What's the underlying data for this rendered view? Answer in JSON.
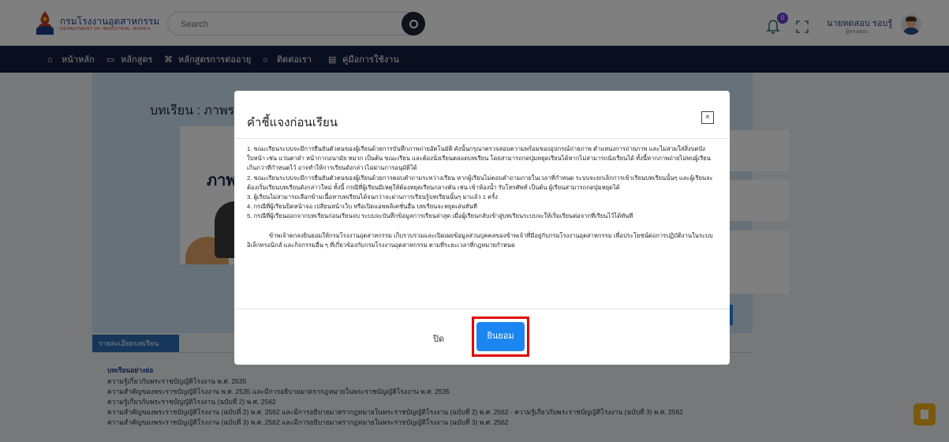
{
  "header": {
    "logo_th": "กรมโรงงานอุตสาหกรรม",
    "logo_en": "DEPARTMENT OF INDUSTRIAL WORKS",
    "search_placeholder": "Search",
    "notification_count": "0",
    "user_name": "นายทดสอบ รอบรู้",
    "user_role": "ผู้ทรงสอบ"
  },
  "nav": {
    "items": [
      {
        "label": "หน้าหลัก",
        "icon": "home-icon"
      },
      {
        "label": "หลักสูตร",
        "icon": "book-icon"
      },
      {
        "label": "หลักสูตรการต่ออายุ",
        "icon": "command-icon"
      },
      {
        "label": "ติดต่อเรา",
        "icon": "chat-icon"
      },
      {
        "label": "คู่มือการใช้งาน",
        "icon": "manual-icon"
      }
    ]
  },
  "page": {
    "lesson_title": "บทเรียน : ภาพร",
    "thumb_text": "ภาพ",
    "detail_tab": "รายละเอียดบทเรียน",
    "summary_heading": "บทเรียนอย่างย่อ",
    "summary_lines": [
      "ความรู้เกี่ยวกับพระราชบัญญัติโรงงาน พ.ศ. 2535",
      "ความสำคัญของพระราชบัญญัติโรงงาน พ.ศ. 2535 และมีการอธิบายมาตรากฎหมายในพระราชบัญญัติโรงงาน พ.ศ. 2535",
      "ความรู้เกี่ยวกับพระราชบัญญัติโรงงาน (ฉบับที่ 2) พ.ศ. 2562",
      "ความสำคัญของพระราชบัญญัติโรงงาน (ฉบับที่ 2) พ.ศ. 2562 และมีการอธิบายมาตรากฎหมายในพระราชบัญญัติโรงงาน (ฉบับที่ 2) พ.ศ. 2562 -  ความรู้เกี่ยวกับพระราชบัญญัติโรงงาน (ฉบับที่ 3) พ.ศ. 2562",
      "ความสำคัญของพระราชบัญญัติโรงงาน (ฉบับที่ 3) พ.ศ. 2562 และมีการอธิบายมาตรากฎหมายในพระราชบัญญัติโรงงาน (ฉบับที่ 3) พ.ศ. 2562"
    ]
  },
  "modal": {
    "title": "คำชี้แจงก่อนเรียน",
    "close_symbol": "×",
    "rules": [
      "1. ขณะเรียนระบบจะมีการยืนยันตัวตนของผู้เรียนด้วยการบันทึกภาพถ่ายอัตโนมัติ ดังนั้นกรุณาตรวจสอบความพร้อมของอุปกรณ์ถ่ายภาพ ตำแหน่งการถ่ายภาพ และไม่สวมใส่สิ่งบดบังใบหน้า เช่น แว่นตาดำ หน้ากากอนามัย หมวก เป็นต้น ขณะเรียน และต้องนั่งเรียนตลอดบทเรียน โดยสามารถกดปุ่มหยุดเรียนได้หากไม่สามารถนั่งเรียนได้ ทั้งนี้หากภาพถ่ายไม่พบผู้เรียนเกินกว่าที่กำหนดไว้ อาจทำให้การเรียนดังกล่าวไม่ผ่านการอนุมัติได้",
      "2. ขณะเรียนระบบจะมีการยืนยันตัวตนของผู้เรียนด้วยการตอบคำถามระหว่างเรียน หากผู้เรียนไม่ตอบคำถามภายในเวลาที่กำหนด ระบบจะยกเลิกการเข้าเรียนบทเรียนนั้นๆ และผู้เรียนจะต้องเริ่มเรียนบทเรียนดังกล่าวใหม่ ทั้งนี้ กรณีที่ผู้เรียนมีเหตุให้ต้องหยุดเรียนกลางคัน เช่น เข้าห้องน้ำ รับโทรศัพท์ เป็นต้น ผู้เรียนสามารถกดปุ่มหยุดได้",
      "3. ผู้เรียนไม่สามารถเลือกข้ามเนื้อหาบทเรียนได้จนกว่าจะผ่านการเรียนรู้บทเรียนนั้นๆ มาแล้ว 1 ครั้ง",
      "4. กรณีที่ผู้เรียนปิดหน้าจอ เปลี่ยนหน้าเว็บ หรือเปิดแอพพลิเคชั่นอื่น บทเรียนจะหยุดเล่นทันที",
      "5. กรณีที่ผู้เรียนออกจากบทเรียนก่อนเรียนจบ ระบบจะบันทึกข้อมูลการเรียนล่าสุด เมื่อผู้เรียนกลับเข้าสู่บทเรียนระบบจะให้เริ่มเรียนต่อจากที่เรียนไว้ได้ทันที"
    ],
    "consent": "ข้าพเจ้าตกลงยินยอมให้กรมโรงงานอุตสาหกรรม เก็บรวบรวมและเปิดเผยข้อมูลส่วนบุคคลของข้าพเจ้าที่มีอยู่กับกรมโรงงานอุตสาหกรรม เพื่อประโยชน์ต่อการปฏิบัติงานในระบบอิเล็กทรอนิกส์ และกิจกรรมอื่น ๆ ที่เกี่ยวข้องกับกรมโรงงานอุตสาหกรรม ตามที่ระยะเวลาที่กฎหมายกำหนด",
    "close_label": "ปิด",
    "accept_label": "ยินยอม"
  },
  "colors": {
    "navbar": "#141f3e",
    "accent_blue": "#1c86f0",
    "highlight_red": "#e00000",
    "detail_tab": "#2c6fb3"
  }
}
